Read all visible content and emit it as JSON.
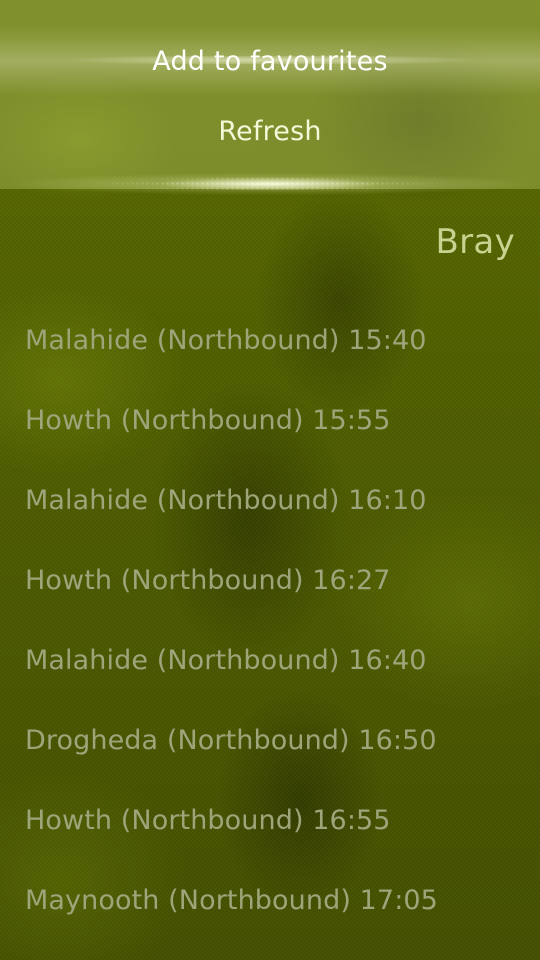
{
  "pulley_menu": {
    "items": [
      {
        "label": "Add to favourites"
      },
      {
        "label": "Refresh"
      }
    ]
  },
  "page": {
    "title": "Bray"
  },
  "departures": [
    {
      "text": "Malahide (Northbound) 15:40"
    },
    {
      "text": "Howth (Northbound) 15:55"
    },
    {
      "text": "Malahide (Northbound) 16:10"
    },
    {
      "text": "Howth (Northbound) 16:27"
    },
    {
      "text": "Malahide (Northbound) 16:40"
    },
    {
      "text": "Drogheda (Northbound) 16:50"
    },
    {
      "text": "Howth (Northbound) 16:55"
    },
    {
      "text": "Maynooth (Northbound) 17:05"
    }
  ],
  "colors": {
    "accent": "#ffffff",
    "header_text": "#c9d28f",
    "list_text": "#9ea57a",
    "background": "#4e5c00"
  }
}
